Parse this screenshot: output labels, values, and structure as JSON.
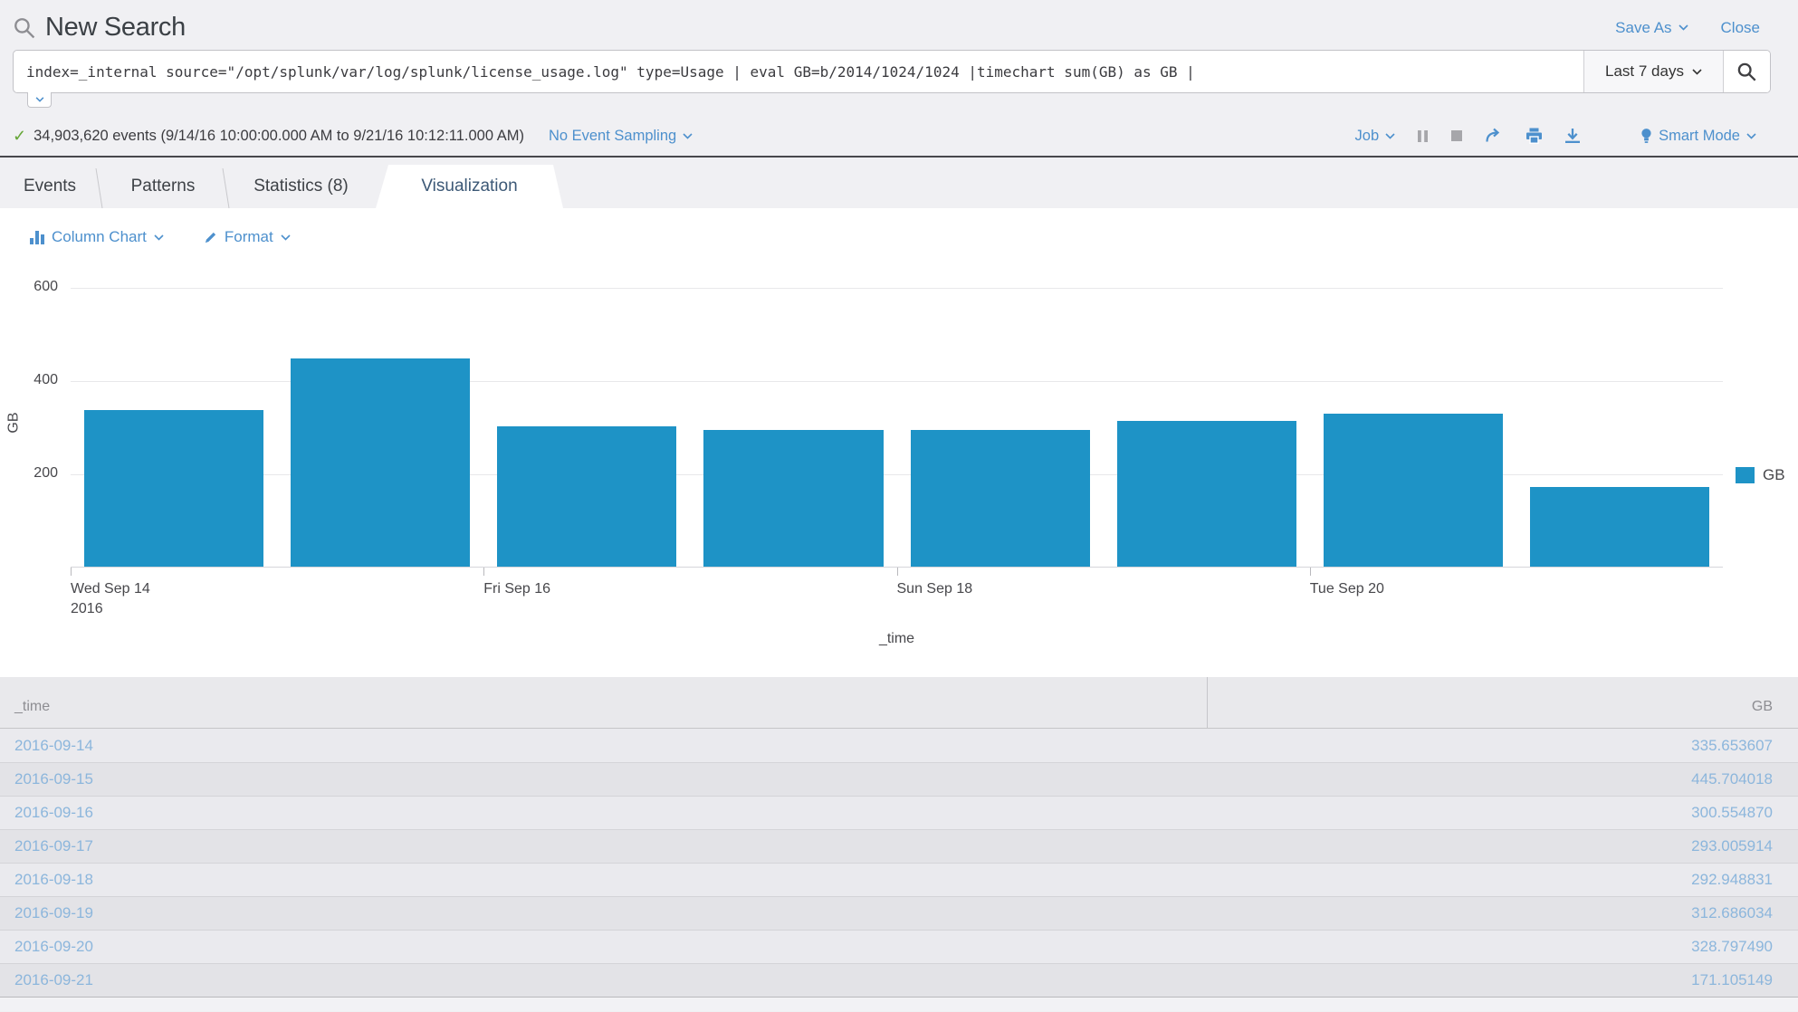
{
  "header": {
    "title": "New Search",
    "save_as_label": "Save As",
    "close_label": "Close"
  },
  "search": {
    "query": "index=_internal source=\"/opt/splunk/var/log/splunk/license_usage.log\" type=Usage | eval GB=b/2014/1024/1024 |timechart sum(GB) as GB |",
    "time_range": "Last 7 days"
  },
  "status": {
    "events": "34,903,620 events (9/14/16 10:00:00.000 AM to 9/21/16 10:12:11.000 AM)",
    "sampling_label": "No Event Sampling",
    "job_label": "Job",
    "mode_label": "Smart Mode"
  },
  "tabs": [
    {
      "label": "Events",
      "active": false
    },
    {
      "label": "Patterns",
      "active": false
    },
    {
      "label": "Statistics (8)",
      "active": false
    },
    {
      "label": "Visualization",
      "active": true
    }
  ],
  "viz_controls": {
    "chart_type_label": "Column Chart",
    "format_label": "Format"
  },
  "chart_data": {
    "type": "bar",
    "categories": [
      "2016-09-14",
      "2016-09-15",
      "2016-09-16",
      "2016-09-17",
      "2016-09-18",
      "2016-09-19",
      "2016-09-20",
      "2016-09-21"
    ],
    "values": [
      335.653607,
      445.704018,
      300.55487,
      293.005914,
      292.948831,
      312.686034,
      328.79749,
      171.105149
    ],
    "series_name": "GB",
    "title": "",
    "xlabel": "_time",
    "ylabel": "GB",
    "ylim": [
      0,
      600
    ],
    "yticks": [
      200,
      400,
      600
    ],
    "grid": true,
    "legend": [
      "GB"
    ],
    "legend_position": "right",
    "x_tick_labels": [
      {
        "line1": "Wed Sep 14",
        "line2": "2016"
      },
      {
        "line1": "Fri Sep 16",
        "line2": ""
      },
      {
        "line1": "Sun Sep 18",
        "line2": ""
      },
      {
        "line1": "Tue Sep 20",
        "line2": ""
      }
    ]
  },
  "table": {
    "columns": [
      "_time",
      "GB"
    ],
    "rows": [
      [
        "2016-09-14",
        "335.653607"
      ],
      [
        "2016-09-15",
        "445.704018"
      ],
      [
        "2016-09-16",
        "300.554870"
      ],
      [
        "2016-09-17",
        "293.005914"
      ],
      [
        "2016-09-18",
        "292.948831"
      ],
      [
        "2016-09-19",
        "312.686034"
      ],
      [
        "2016-09-20",
        "328.797490"
      ],
      [
        "2016-09-21",
        "171.105149"
      ]
    ]
  },
  "colors": {
    "bar": "#1e93c6",
    "link": "#4d90cd",
    "table_link": "#8cb6dc",
    "success": "#65a637"
  }
}
